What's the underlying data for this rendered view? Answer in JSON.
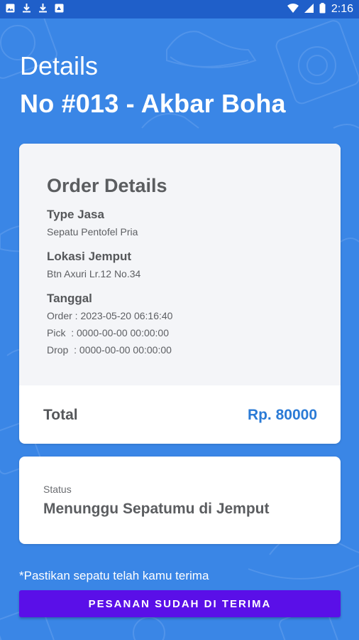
{
  "status_bar": {
    "time": "2:16",
    "left_icons": [
      "image-icon",
      "download-icon",
      "download-icon",
      "photo-icon"
    ],
    "right_icons": [
      "wifi-icon",
      "signal-icon",
      "battery-icon"
    ]
  },
  "header": {
    "title": "Details",
    "subtitle": "No #013 - Akbar Boha"
  },
  "order": {
    "title": "Order Details",
    "type_label": "Type Jasa",
    "type_value": "Sepatu Pentofel Pria",
    "location_label": "Lokasi Jemput",
    "location_value": "Btn Axuri Lr.12 No.34",
    "date_label": "Tanggal",
    "order_date": "Order : 2023-05-20 06:16:40",
    "pick_date": "Pick  : 0000-00-00 00:00:00",
    "drop_date": "Drop  : 0000-00-00 00:00:00",
    "total_label": "Total",
    "total_value": "Rp. 80000"
  },
  "status": {
    "label": "Status",
    "value": "Menunggu Sepatumu di Jemput"
  },
  "note": "*Pastikan sepatu telah kamu terima",
  "confirm_button": "PESANAN SUDAH DI TERIMA",
  "colors": {
    "background": "#3a86e6",
    "status_bar": "#1f5fc9",
    "accent_total": "#2b7bd6",
    "button": "#5a0fe8"
  }
}
